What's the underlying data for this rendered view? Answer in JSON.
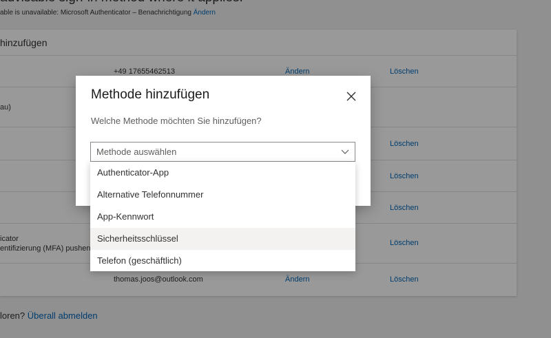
{
  "background": {
    "heading_partial": "advisable sign-in method where it applies.",
    "sub_info_text": "able is unavailable: Microsoft Authenticator – Benachrichtigung",
    "sub_info_link": "Ändern",
    "card_title": "hinzufügen",
    "rows": [
      {
        "c1": "",
        "c1b": "",
        "c2": "+49 17655462513",
        "c3": "Ändern",
        "c4": "Löschen"
      },
      {
        "c1": "au)",
        "c1b": "",
        "c2": "",
        "c3": "",
        "c4": ""
      },
      {
        "c1": "",
        "c1b": "",
        "c2": "",
        "c3": "",
        "c4": "Löschen"
      },
      {
        "c1": "",
        "c1b": "",
        "c2": "",
        "c3": "",
        "c4": "Löschen"
      },
      {
        "c1": "",
        "c1b": "",
        "c2": "",
        "c3": "",
        "c4": "Löschen"
      },
      {
        "c1": "icator",
        "c1b": "entifizierung (MFA) pushen",
        "c2": "",
        "c3": "",
        "c4": "Löschen"
      },
      {
        "c1": "",
        "c1b": "",
        "c2": "thomas.joos@outlook.com",
        "c3": "Ändern",
        "c4": "Löschen"
      }
    ],
    "bottom_text": "loren?",
    "bottom_link": "Überall abmelden"
  },
  "dialog": {
    "title": "Methode hinzufügen",
    "question": "Welche Methode möchten Sie hinzufügen?",
    "select_placeholder": "Methode auswählen",
    "options": [
      "Authenticator-App",
      "Alternative Telefonnummer",
      "App-Kennwort",
      "Sicherheitsschlüssel",
      "Telefon (geschäftlich)"
    ],
    "hovered_option": "Sicherheitsschlüssel"
  },
  "colors": {
    "link": "#0067b8",
    "overlay": "rgba(0,0,0,0.40)",
    "hover": "#f3f2f1"
  },
  "icons": {
    "close": "close-icon",
    "chevron": "chevron-down-icon"
  }
}
